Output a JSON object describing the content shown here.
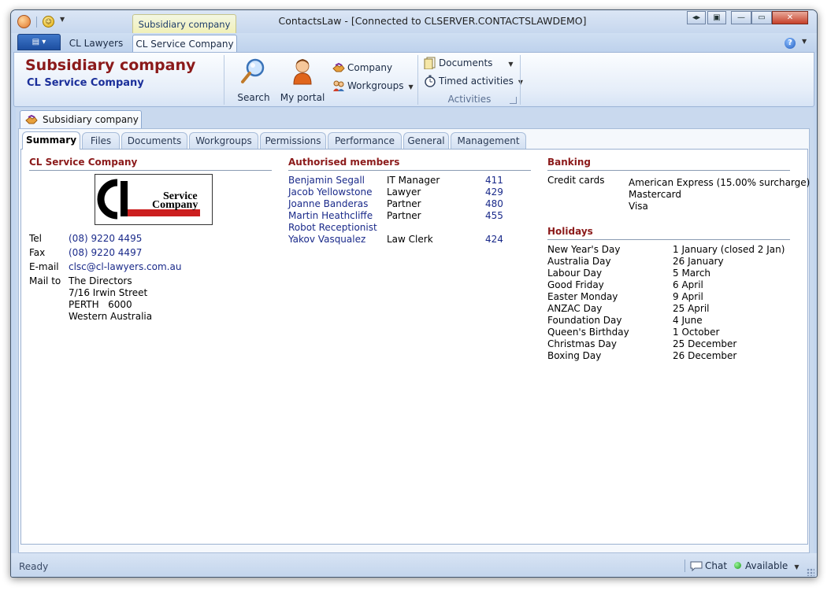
{
  "window": {
    "title": "ContactsLaw - [Connected to CLSERVER.CONTACTSLAWDEMO]",
    "context_tab": "Subsidiary company",
    "caption_buttons": [
      "◂▸",
      "▣",
      "—",
      "▭",
      "✕"
    ]
  },
  "ribbon_tabs": {
    "items": [
      "CL Lawyers",
      "CL Service Company"
    ],
    "active": "CL Service Company"
  },
  "ribbon": {
    "title": "Subsidiary company",
    "subtitle": "CL Service Company",
    "search_label": "Search",
    "portal_label": "My portal",
    "company_label": "Company",
    "workgroups_label": "Workgroups",
    "documents_label": "Documents",
    "timed_activities_label": "Timed activities",
    "activities_group_label": "Activities"
  },
  "document": {
    "tab_label": "Subsidiary company",
    "inner_tabs": [
      "Summary",
      "Files",
      "Documents",
      "Workgroups",
      "Permissions",
      "Performance",
      "General",
      "Management"
    ],
    "active_tab": "Summary"
  },
  "company": {
    "heading": "CL Service Company",
    "logo_text_1": "Service",
    "logo_text_2": "Company",
    "logo_mark": "CL",
    "contacts": [
      {
        "label": "Tel",
        "value": "(08) 9220 4495"
      },
      {
        "label": "Fax",
        "value": "(08) 9220 4497"
      },
      {
        "label": "E-mail",
        "value": "clsc@cl-lawyers.com.au"
      }
    ],
    "mail_label": "Mail to",
    "mail_lines": [
      "The Directors",
      "7/16 Irwin Street",
      "PERTH   6000",
      "Western Australia"
    ]
  },
  "members": {
    "heading": "Authorised members",
    "rows": [
      {
        "name": "Benjamin Segall",
        "role": "IT Manager",
        "ext": "411"
      },
      {
        "name": "Jacob Yellowstone",
        "role": "Lawyer",
        "ext": "429"
      },
      {
        "name": "Joanne Banderas",
        "role": "Partner",
        "ext": "480"
      },
      {
        "name": "Martin Heathcliffe",
        "role": "Partner",
        "ext": "455"
      },
      {
        "name": "Robot Receptionist",
        "role": "",
        "ext": ""
      },
      {
        "name": "Yakov Vasqualez",
        "role": "Law Clerk",
        "ext": "424"
      }
    ]
  },
  "banking": {
    "heading": "Banking",
    "label": "Credit cards",
    "cards": [
      "American Express (15.00% surcharge)",
      "Mastercard",
      "Visa"
    ]
  },
  "holidays": {
    "heading": "Holidays",
    "rows": [
      {
        "name": "New Year's Day",
        "date": "1 January (closed 2 Jan)"
      },
      {
        "name": "Australia Day",
        "date": "26 January"
      },
      {
        "name": "Labour Day",
        "date": "5 March"
      },
      {
        "name": "Good Friday",
        "date": "6 April"
      },
      {
        "name": "Easter Monday",
        "date": "9 April"
      },
      {
        "name": "ANZAC Day",
        "date": "25 April"
      },
      {
        "name": "Foundation Day",
        "date": "4 June"
      },
      {
        "name": "Queen's Birthday",
        "date": "1 October"
      },
      {
        "name": "Christmas Day",
        "date": "25 December"
      },
      {
        "name": "Boxing Day",
        "date": "26 December"
      }
    ]
  },
  "status": {
    "text": "Ready",
    "chat_label": "Chat",
    "availability": "Available"
  },
  "colors": {
    "heading_red": "#8b1a1a",
    "link_blue": "#1a2a8a",
    "accent_blue": "#1b2f9a",
    "window_frame": "#c3d6ef"
  }
}
